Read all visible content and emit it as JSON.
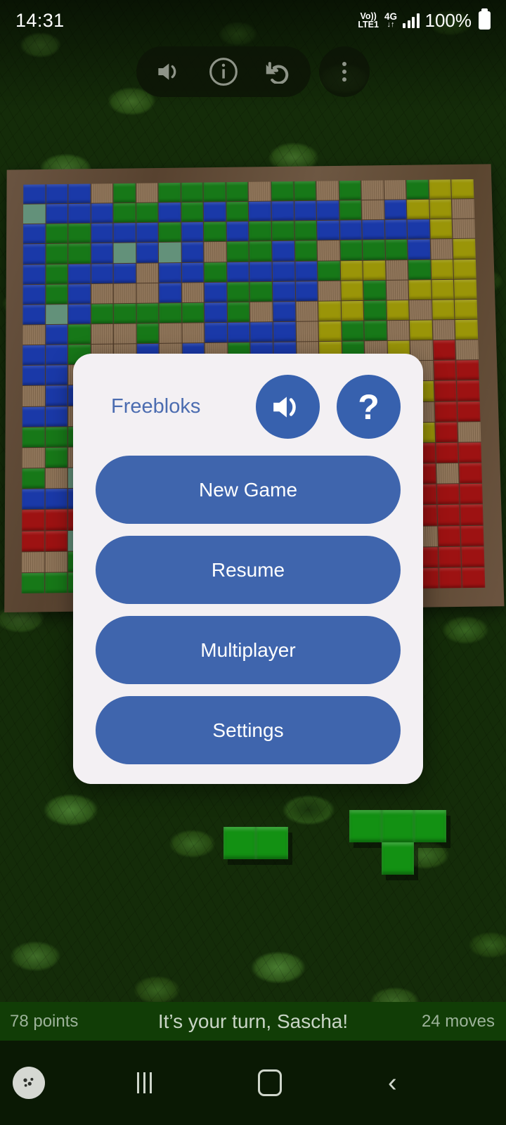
{
  "status_bar": {
    "time": "14:31",
    "volte": "Vo))",
    "volte_sub": "LTE1",
    "network": "4G",
    "data_arrows": "↓↑",
    "battery_percent": "100%",
    "signal_icon": "signal-bars-icon",
    "battery_icon": "battery-full-icon"
  },
  "toolbar": {
    "sound_icon": "speaker-on-icon",
    "info_icon": "info-circle-icon",
    "undo_icon": "undo-arrow-icon",
    "overflow_icon": "three-dots-menu-icon"
  },
  "dialog": {
    "title": "Freebloks",
    "sound_icon": "speaker-on-icon",
    "help_icon": "question-mark-icon",
    "help_label": "?",
    "buttons": [
      {
        "label": "New Game",
        "name": "new-game-button"
      },
      {
        "label": "Resume",
        "name": "resume-button"
      },
      {
        "label": "Multiplayer",
        "name": "multiplayer-button"
      },
      {
        "label": "Settings",
        "name": "settings-button"
      }
    ]
  },
  "game_status": {
    "points": "78 points",
    "turn_message": "It’s your turn, Sascha!",
    "moves": "24 moves"
  },
  "nav_bar": {
    "gamepad_icon": "game-launcher-icon",
    "recents_icon": "recents-icon",
    "home_icon": "home-icon",
    "back_icon": "back-icon"
  },
  "colors": {
    "accent_blue": "#3761ae",
    "button_blue": "#3f65ad",
    "dialog_bg": "#f3f0f3",
    "title_blue": "#4b6cb0",
    "status_strip": "#113d06",
    "piece_blue": "#1a39a8",
    "piece_green": "#177818",
    "piece_yellow": "#9a9508",
    "piece_red": "#9d1212"
  },
  "board": {
    "rows": 20,
    "cols": 20,
    "legend": {
      "b": "blue",
      "g": "green",
      "y": "yellow",
      "r": "red",
      "h": "highlight",
      ".": "empty"
    },
    "grid": [
      "bbb.g.gggg.gg.g..gyy",
      "hbbbggbgbgbbbbg.byy.",
      "bggbbbgbgbgggbbbbby.",
      "bggbhbhb.ggbg.gggb.y",
      "bgbbb.bbgbbbbgyy.gyy",
      "bgb...b.bggbb.yg.yyy",
      "bhbgggggbg.b.yygy.yy",
      ".bg..g..bbbb.ygg.y.y",
      "bbg..b.b.gbb.yg.y.r.",
      "bb.gg...b.bby.g.y.rr",
      ".bb.g.gggbbyyg.yyyrr",
      "bb.gg..ggb.yygyyy.rr",
      "gggg.bbbgg.yyy.yyyr.",
      ".g.g.bbg.yyyyy.r.rrr",
      "g.hbbbbgyyy.yy.rrr.r",
      "bbb.bbgg.y.yyyrr.rrr",
      "rrr.bgg.yyy.yyr.rrrr",
      "rrh.g.gg.yy.yyrrr.rr",
      "..g.ggy.hyy.yyyrrrrr",
      "gggg.gyyyy.yyy.rrrrr"
    ]
  },
  "loose_pieces": [
    {
      "name": "domino-piece-green",
      "cells": [
        [
          0,
          0
        ],
        [
          1,
          0
        ]
      ]
    },
    {
      "name": "t-piece-green",
      "cells": [
        [
          0,
          0
        ],
        [
          1,
          0
        ],
        [
          2,
          0
        ],
        [
          1,
          1
        ]
      ]
    }
  ]
}
